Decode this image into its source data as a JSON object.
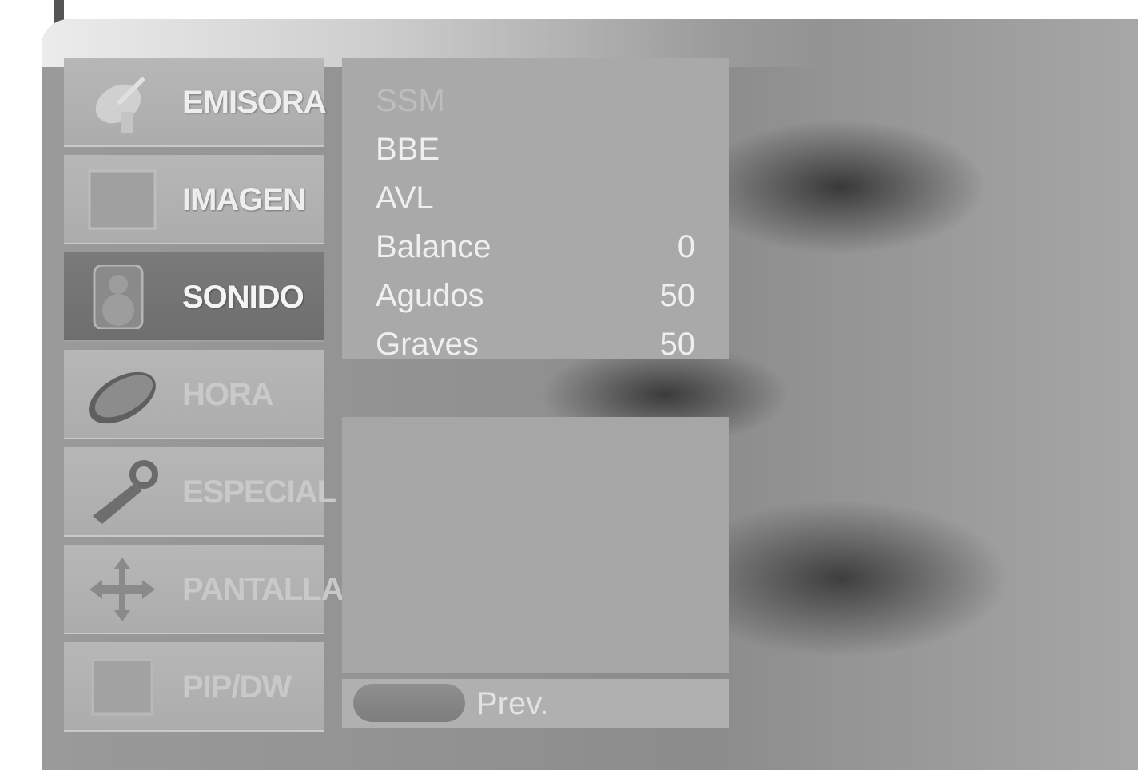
{
  "sidebar": {
    "items": [
      {
        "label": "EMISORA",
        "icon": "satellite-dish-icon",
        "active": false
      },
      {
        "label": "IMAGEN",
        "icon": "picture-icon",
        "active": false
      },
      {
        "label": "SONIDO",
        "icon": "speaker-icon",
        "active": true
      },
      {
        "label": "HORA",
        "icon": "clock-icon",
        "active": false
      },
      {
        "label": "ESPECIAL",
        "icon": "key-icon",
        "active": false
      },
      {
        "label": "PANTALLA",
        "icon": "move-arrows-icon",
        "active": false
      },
      {
        "label": "PIP/DW",
        "icon": "pip-icon",
        "active": false
      }
    ]
  },
  "submenu": {
    "rows": [
      {
        "label": "SSM",
        "value": "",
        "enabled": false
      },
      {
        "label": "BBE",
        "value": "",
        "enabled": true
      },
      {
        "label": "AVL",
        "value": "",
        "enabled": true
      },
      {
        "label": "Balance",
        "value": "0",
        "enabled": true
      },
      {
        "label": "Agudos",
        "value": "50",
        "enabled": true
      },
      {
        "label": "Graves",
        "value": "50",
        "enabled": true
      }
    ]
  },
  "footer": {
    "prev_label": "Prev."
  }
}
